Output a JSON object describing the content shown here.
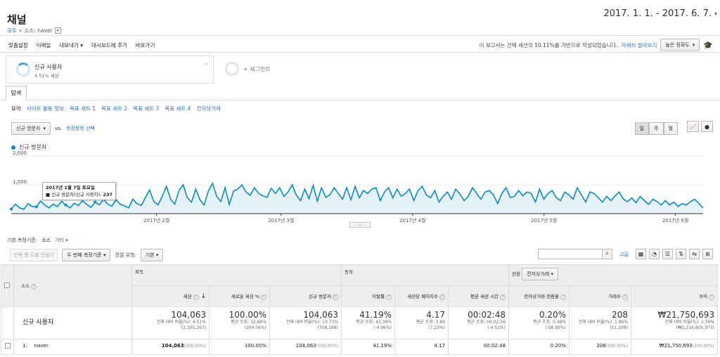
{
  "page": {
    "title": "채널",
    "breadcrumb_all": "모두",
    "breadcrumb_sep": "»",
    "breadcrumb_filter": "소스: naver"
  },
  "date_range": "2017. 1. 1. - 2017. 6. 7.",
  "toolbar": {
    "items": [
      "맞춤설정",
      "이메일",
      "내보내기 ▾",
      "대시보드에 추가",
      "바로가기"
    ],
    "notice": "이 보고서는 전체 세션의 10.11%를 기반으로 작성되었습니다.",
    "notice_link": "자세히 알아보기",
    "precision": "높은 정확도"
  },
  "segment": {
    "name": "신규 사용자",
    "sub": "4.51% 세션",
    "add": "+ 세그먼트"
  },
  "tab": "탐색",
  "subtabs": [
    "요약",
    "사이트 활용 정보",
    "목표 세트 1",
    "목표 세트 2",
    "목표 세트 3",
    "목표 세트 4",
    "전자상거래"
  ],
  "metric": {
    "selected": "신규 방문자",
    "vs": "vs.",
    "select_link": "측정항목 선택"
  },
  "granularity": [
    "일",
    "주",
    "월"
  ],
  "legend": "신규 방문자",
  "tooltip": {
    "date": "2017년 1월 7일 토요일",
    "label": "신규 방문자(신규 사용자):",
    "value": "237"
  },
  "chart_data": {
    "type": "area",
    "series": [
      {
        "name": "신규 방문자",
        "values": [
          160,
          330,
          200,
          150,
          350,
          250,
          237,
          440,
          300,
          200,
          330,
          250,
          430,
          300,
          200,
          360,
          280,
          450,
          320,
          220,
          400,
          300,
          500,
          330,
          260,
          480,
          320,
          270,
          200,
          500,
          350,
          280,
          560,
          820,
          420,
          300,
          600,
          950,
          500,
          330,
          800,
          1000,
          550,
          400,
          850,
          480,
          300,
          780,
          1050,
          600,
          420,
          900,
          320,
          780,
          850,
          1000,
          750,
          640,
          900,
          700,
          620,
          560,
          880,
          700,
          900,
          600,
          750,
          1000,
          640,
          450,
          850,
          520,
          980,
          430,
          900,
          560,
          650,
          900,
          700,
          500,
          900,
          480,
          950,
          550,
          800,
          700,
          850,
          900,
          450,
          750,
          900,
          550,
          850,
          600,
          700,
          850,
          450,
          800,
          950,
          650,
          550,
          800,
          400,
          600,
          750,
          500,
          850,
          680,
          450,
          600,
          900,
          700,
          500,
          750,
          800,
          650,
          350,
          700,
          900,
          560,
          600,
          800,
          620,
          750,
          700,
          400,
          850,
          500,
          700,
          800,
          550,
          450,
          750,
          650,
          500,
          900,
          640,
          400,
          750,
          700,
          550,
          400,
          600,
          450,
          620,
          750,
          500,
          420,
          550,
          380,
          600,
          450,
          320,
          500,
          420,
          300,
          450,
          300,
          400,
          250,
          350,
          300,
          420,
          500,
          350,
          200
        ]
      }
    ],
    "y_ticks": [
      1000,
      2000
    ],
    "y_tick_labels": [
      "1,000",
      "2,000"
    ],
    "ylim": [
      0,
      2000
    ],
    "x_ticks": [
      "2017년 2월",
      "2017년 3월",
      "2017년 4월",
      "2017년 5월",
      "2017년 6월"
    ],
    "colors": {
      "line": "#058dc7",
      "fill": "#e6f2fa"
    }
  },
  "dimension": {
    "label": "기본 측정기준:",
    "current": "소스",
    "other": "기타 ▾"
  },
  "table_tools": {
    "plot_rows": "선택 행 도표 만들기",
    "secondary": "두 번째 측정기준 ▾",
    "sort_label": "정렬 유형:",
    "sort_value": "기본 ▾",
    "advanced": "고급"
  },
  "table": {
    "col_source": "소스",
    "groups": {
      "acq": "획득",
      "beh": "동작",
      "conv": "전환",
      "conv_sel": "전자상거래 ▾"
    },
    "headers": [
      "세션",
      "새로운 세션 %",
      "신규 방문자",
      "이탈률",
      "세션당 페이지수",
      "평균 세션 시간",
      "전자상거래 전환율",
      "거래수",
      "수익"
    ],
    "summary_label": "신규 사용자",
    "summary": [
      {
        "big": "104,063",
        "l1": "전체 대비 비율(%): 4.51%",
        "l2": "(2,305,267)"
      },
      {
        "big": "100.00%",
        "l1": "평균 조회: 32.89%",
        "l2": "(204.06%)"
      },
      {
        "big": "104,063",
        "l1": "전체 대비 비율(%): 13.73%",
        "l2": "(758,168)"
      },
      {
        "big": "41.19%",
        "l1": "평균 조회: 43.34%",
        "l2": "(-4.96%)"
      },
      {
        "big": "4.17",
        "l1": "평균 조회: 3.89",
        "l2": "(7.23%)"
      },
      {
        "big": "00:02:48",
        "l1": "평균 조회: 00:02:56",
        "l2": "(-4.51%)"
      },
      {
        "big": "0.20%",
        "l1": "평균 조회: 0.49%",
        "l2": "(-58.89%)"
      },
      {
        "big": "208",
        "l1": "전체 대비 비율(%): 1.86%",
        "l2": "(11,208)"
      },
      {
        "big": "₩21,750,693",
        "l1": "전체 대비 비율(%): 1.79%",
        "l2": "(₩1,216,805,973)"
      }
    ],
    "rows": [
      {
        "index": "1.",
        "source": "naver",
        "cells": [
          {
            "v": "104,063",
            "p": "(100.00%)"
          },
          {
            "v": "100.00%",
            "p": ""
          },
          {
            "v": "104,063",
            "p": "(100.00%)"
          },
          {
            "v": "41.19%",
            "p": ""
          },
          {
            "v": "4.17",
            "p": ""
          },
          {
            "v": "00:02:48",
            "p": ""
          },
          {
            "v": "0.20%",
            "p": ""
          },
          {
            "v": "208",
            "p": "(100.00%)"
          },
          {
            "v": "₩21,750,693",
            "p": "(100.00%)"
          }
        ]
      }
    ]
  }
}
